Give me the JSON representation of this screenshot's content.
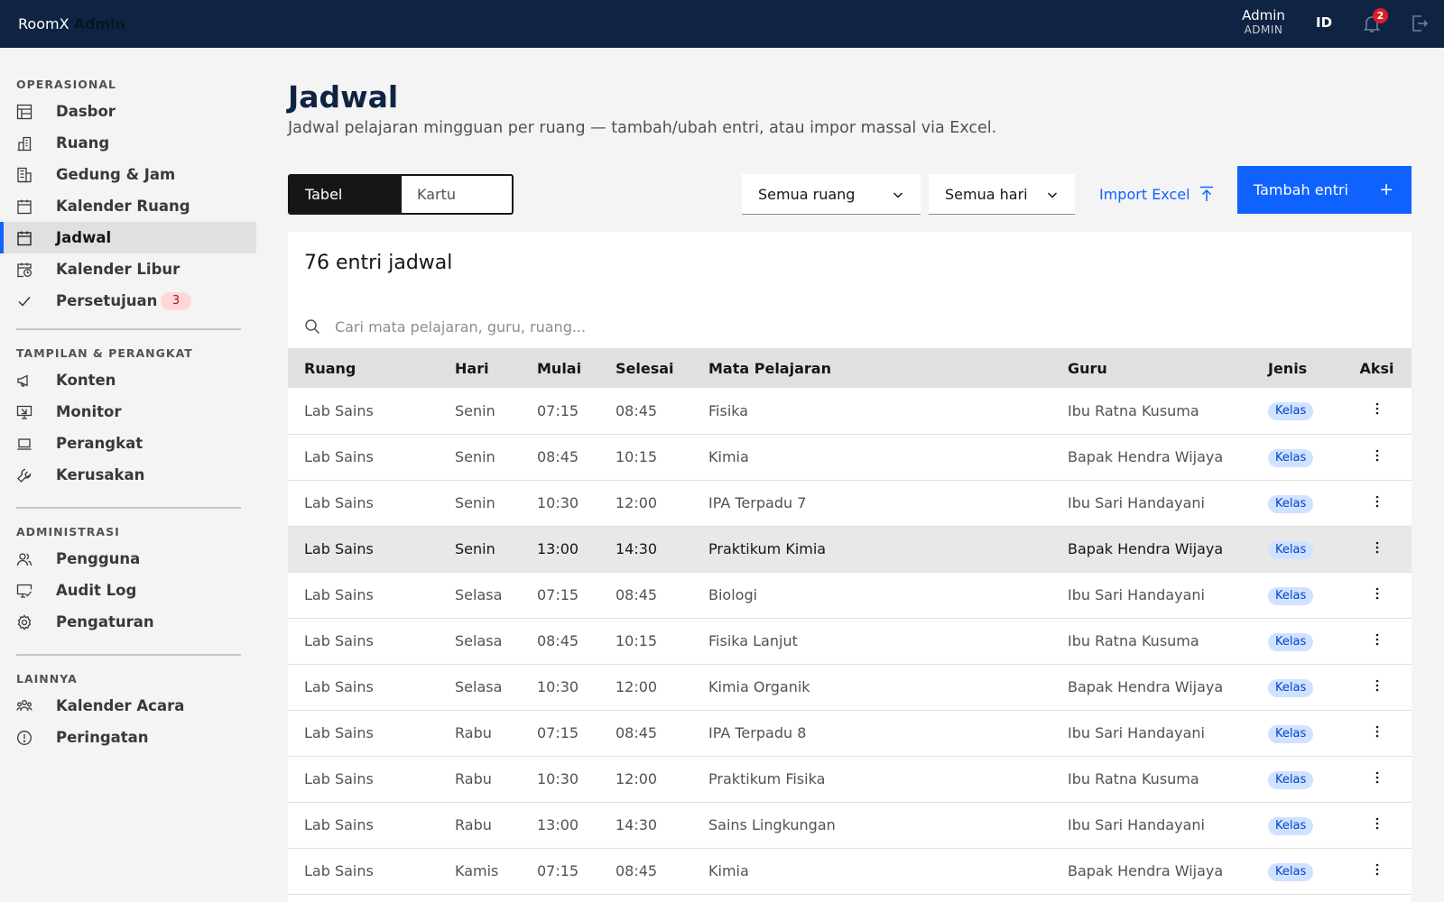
{
  "header": {
    "brand_main": "RoomX",
    "brand_sub": "Admin",
    "user_name": "Admin",
    "user_role": "ADMIN",
    "language": "ID",
    "notification_count": "2"
  },
  "sidebar": {
    "sections": [
      {
        "title": "OPERASIONAL"
      },
      {
        "title": "TAMPILAN & PERANGKAT"
      },
      {
        "title": "ADMINISTRASI"
      },
      {
        "title": "LAINNYA"
      }
    ],
    "items": [
      {
        "label": "Dasbor",
        "icon": "dashboard-icon"
      },
      {
        "label": "Ruang",
        "icon": "building-icon"
      },
      {
        "label": "Gedung & Jam",
        "icon": "building-clock-icon"
      },
      {
        "label": "Kalender Ruang",
        "icon": "calendar-icon"
      },
      {
        "label": "Jadwal",
        "icon": "calendar-icon",
        "active": true
      },
      {
        "label": "Kalender Libur",
        "icon": "calendar-clock-icon"
      },
      {
        "label": "Persetujuan",
        "icon": "checkmark-icon",
        "badge": "3"
      },
      {
        "label": "Konten",
        "icon": "megaphone-icon"
      },
      {
        "label": "Monitor",
        "icon": "monitor-icon"
      },
      {
        "label": "Perangkat",
        "icon": "laptop-icon"
      },
      {
        "label": "Kerusakan",
        "icon": "wrench-icon"
      },
      {
        "label": "Pengguna",
        "icon": "users-icon"
      },
      {
        "label": "Audit Log",
        "icon": "audit-icon"
      },
      {
        "label": "Pengaturan",
        "icon": "gear-icon"
      },
      {
        "label": "Kalender Acara",
        "icon": "group-icon"
      },
      {
        "label": "Peringatan",
        "icon": "warning-icon"
      }
    ]
  },
  "main": {
    "title": "Jadwal",
    "subtitle": "Jadwal pelajaran mingguan per ruang — tambah/ubah entri, atau impor massal via Excel.",
    "view_toggle": {
      "table": "Tabel",
      "cards": "Kartu",
      "selected": "Tabel"
    },
    "filter_room": "Semua ruang",
    "filter_day": "Semua hari",
    "import_label": "Import Excel",
    "add_label": "Tambah entri",
    "count_label": "76 entri jadwal",
    "search_placeholder": "Cari mata pelajaran, guru, ruang..."
  },
  "table": {
    "columns": [
      "Ruang",
      "Hari",
      "Mulai",
      "Selesai",
      "Mata Pelajaran",
      "Guru",
      "Jenis",
      "Aksi"
    ],
    "rows": [
      {
        "ruang": "Lab Sains",
        "hari": "Senin",
        "mulai": "07:15",
        "selesai": "08:45",
        "mapel": "Fisika",
        "guru": "Ibu Ratna Kusuma",
        "jenis": "Kelas"
      },
      {
        "ruang": "Lab Sains",
        "hari": "Senin",
        "mulai": "08:45",
        "selesai": "10:15",
        "mapel": "Kimia",
        "guru": "Bapak Hendra Wijaya",
        "jenis": "Kelas"
      },
      {
        "ruang": "Lab Sains",
        "hari": "Senin",
        "mulai": "10:30",
        "selesai": "12:00",
        "mapel": "IPA Terpadu 7",
        "guru": "Ibu Sari Handayani",
        "jenis": "Kelas"
      },
      {
        "ruang": "Lab Sains",
        "hari": "Senin",
        "mulai": "13:00",
        "selesai": "14:30",
        "mapel": "Praktikum Kimia",
        "guru": "Bapak Hendra Wijaya",
        "jenis": "Kelas",
        "highlight": true
      },
      {
        "ruang": "Lab Sains",
        "hari": "Selasa",
        "mulai": "07:15",
        "selesai": "08:45",
        "mapel": "Biologi",
        "guru": "Ibu Sari Handayani",
        "jenis": "Kelas"
      },
      {
        "ruang": "Lab Sains",
        "hari": "Selasa",
        "mulai": "08:45",
        "selesai": "10:15",
        "mapel": "Fisika Lanjut",
        "guru": "Ibu Ratna Kusuma",
        "jenis": "Kelas"
      },
      {
        "ruang": "Lab Sains",
        "hari": "Selasa",
        "mulai": "10:30",
        "selesai": "12:00",
        "mapel": "Kimia Organik",
        "guru": "Bapak Hendra Wijaya",
        "jenis": "Kelas"
      },
      {
        "ruang": "Lab Sains",
        "hari": "Rabu",
        "mulai": "07:15",
        "selesai": "08:45",
        "mapel": "IPA Terpadu 8",
        "guru": "Ibu Sari Handayani",
        "jenis": "Kelas"
      },
      {
        "ruang": "Lab Sains",
        "hari": "Rabu",
        "mulai": "10:30",
        "selesai": "12:00",
        "mapel": "Praktikum Fisika",
        "guru": "Ibu Ratna Kusuma",
        "jenis": "Kelas"
      },
      {
        "ruang": "Lab Sains",
        "hari": "Rabu",
        "mulai": "13:00",
        "selesai": "14:30",
        "mapel": "Sains Lingkungan",
        "guru": "Ibu Sari Handayani",
        "jenis": "Kelas"
      },
      {
        "ruang": "Lab Sains",
        "hari": "Kamis",
        "mulai": "07:15",
        "selesai": "08:45",
        "mapel": "Kimia",
        "guru": "Bapak Hendra Wijaya",
        "jenis": "Kelas"
      }
    ]
  },
  "colors": {
    "topbar": "#0f2442",
    "primary": "#0f62fe",
    "tag_bg": "#d0e2ff",
    "tag_text": "#0043ce",
    "badge_red": "#da1e28"
  }
}
